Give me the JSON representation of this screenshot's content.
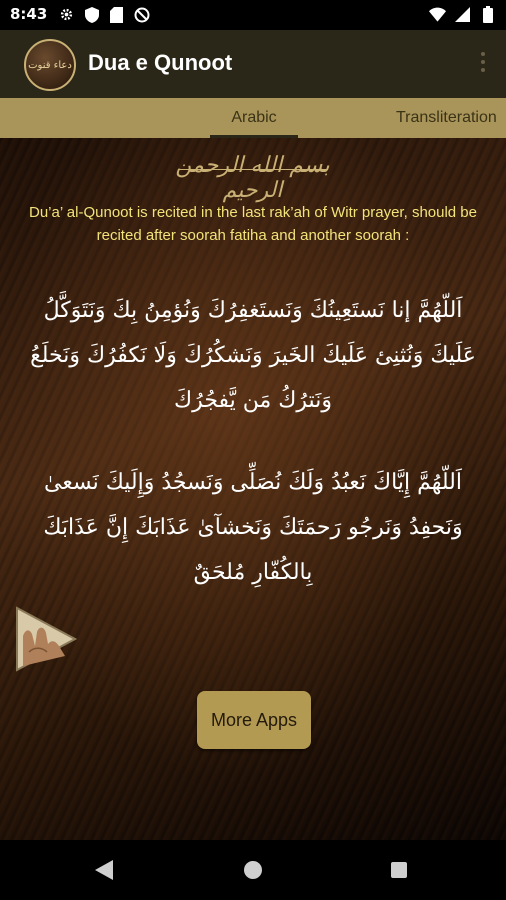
{
  "status_bar": {
    "time": "8:43",
    "left_icons": [
      "settings-icon",
      "shield-icon",
      "sd-card-icon",
      "no-sim-icon"
    ],
    "right_icons": [
      "wifi-icon",
      "signal-icon",
      "battery-icon"
    ]
  },
  "app_bar": {
    "logo_text": "دعاء قنوت",
    "title": "Dua e Qunoot"
  },
  "tabs": [
    {
      "label": "Arabic",
      "selected": true
    },
    {
      "label": "Transliteration",
      "selected": false
    }
  ],
  "content": {
    "bismillah": "بسم الله الرحمن الرحيم",
    "intro": "Du’a’ al-Qunoot is recited in the last rak’ah of Witr prayer, should be recited after soorah fatiha and another soorah :",
    "dua_paragraph_1": "اَللّهُمَّ إنا نَستَعِينُكَ وَنَستَغفِرُكَ وَنُؤمِنُ بِكَ وَنَتَوَكَّلُ عَلَيكَ وَنُثنِئ عَلَيكَ الخَيرَ وَنَشكُرُكَ وَلَا نَكفُرُكَ وَنَخلَعُ وَنَترُكُ مَن يَّفجُرُكَ",
    "dua_paragraph_2": "اَللّهُمَّ إِيَّاكَ نَعبُدُ وَلَكَ نُصَلِّى وَنَسجُدُ وَإِلَيكَ نَسعىٰ وَنَحفِدُ وَنَرجُو رَحمَتَكَ وَنَخشآیٰ عَذَابَكَ إِنَّ عَذَابَكَ بِالكُفّارِ مُلحَقٌ"
  },
  "more_apps_label": "More Apps",
  "colors": {
    "app_bar": "#2a2618",
    "tab_bar": "#a9955a",
    "accent_gold": "#b39a52",
    "intro_text": "#f2e37a"
  }
}
